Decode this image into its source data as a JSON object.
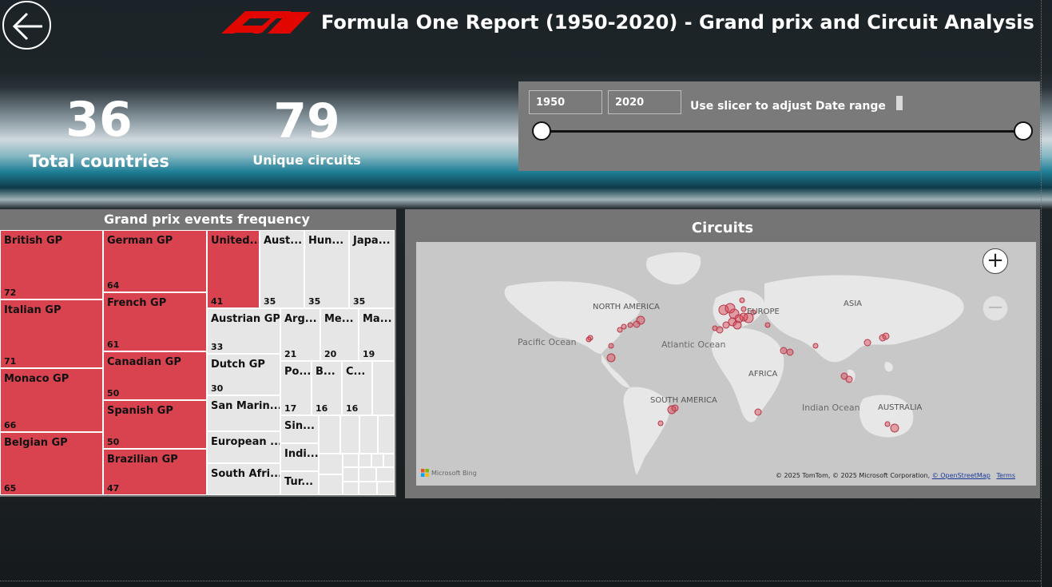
{
  "header": {
    "title": "Formula One Report (1950-2020) - Grand prix and Circuit Analysis",
    "back_icon": "arrow-left-icon",
    "logo_icon": "f1-logo-icon",
    "brand_color": "#e10600"
  },
  "kpis": {
    "countries": {
      "value": "36",
      "label": "Total countries"
    },
    "circuits": {
      "value": "79",
      "label": "Unique circuits"
    }
  },
  "slicer": {
    "start": "1950",
    "end": "2020",
    "hint": "Use slicer to adjust Date range",
    "start_fraction": 0,
    "end_fraction": 1
  },
  "treemap": {
    "title": "Grand prix events frequency",
    "highlight_color": "#d94350",
    "items": [
      {
        "label": "British GP",
        "value": "72"
      },
      {
        "label": "Italian GP",
        "value": "71"
      },
      {
        "label": "Monaco GP",
        "value": "66"
      },
      {
        "label": "Belgian GP",
        "value": "65"
      },
      {
        "label": "German GP",
        "value": "64"
      },
      {
        "label": "French GP",
        "value": "61"
      },
      {
        "label": "Canadian GP",
        "value": "50"
      },
      {
        "label": "Spanish GP",
        "value": "50"
      },
      {
        "label": "Brazilian GP",
        "value": "47"
      },
      {
        "label": "United...",
        "value": "41"
      },
      {
        "label": "Aust...",
        "value": "35"
      },
      {
        "label": "Hun...",
        "value": "35"
      },
      {
        "label": "Japa...",
        "value": "35"
      },
      {
        "label": "Austrian GP",
        "value": "33"
      },
      {
        "label": "Dutch GP",
        "value": "30"
      },
      {
        "label": "San Marin...",
        "value": ""
      },
      {
        "label": "European ...",
        "value": ""
      },
      {
        "label": "South Afri...",
        "value": ""
      },
      {
        "label": "Arg...",
        "value": "21"
      },
      {
        "label": "Me...",
        "value": "20"
      },
      {
        "label": "Ma...",
        "value": "19"
      },
      {
        "label": "Po...",
        "value": "17"
      },
      {
        "label": "B...",
        "value": "16"
      },
      {
        "label": "C...",
        "value": "16"
      },
      {
        "label": "Sin...",
        "value": ""
      },
      {
        "label": "Indi...",
        "value": ""
      },
      {
        "label": "Tur...",
        "value": ""
      }
    ]
  },
  "map": {
    "title": "Circuits",
    "zoom_in": "+",
    "zoom_out": "−",
    "continents": [
      "NORTH AMERICA",
      "EUROPE",
      "ASIA",
      "AFRICA",
      "SOUTH AMERICA",
      "AUSTRALIA"
    ],
    "oceans": [
      "Pacific Ocean",
      "Atlantic Ocean",
      "Indian Ocean"
    ],
    "bing": "Microsoft Bing",
    "credit": "© 2025 TomTom, © 2025 Microsoft Corporation,",
    "osm": "© OpenStreetMap",
    "terms": "Terms"
  }
}
